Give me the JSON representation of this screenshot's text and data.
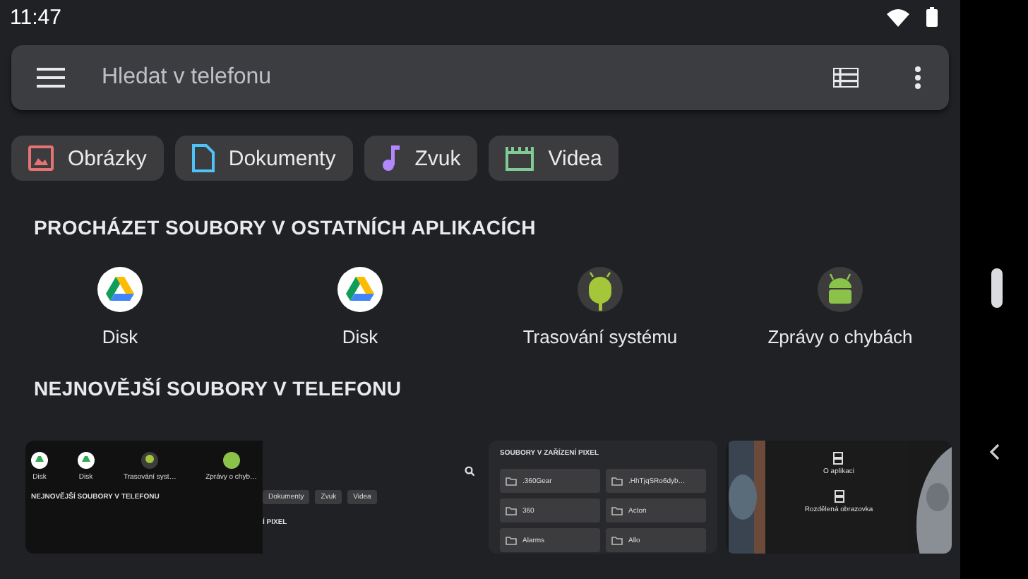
{
  "status_bar": {
    "time": "11:47"
  },
  "search": {
    "placeholder": "Hledat v telefonu"
  },
  "categories": [
    {
      "label": "Obrázky",
      "kind": "images",
      "color": "#e57373"
    },
    {
      "label": "Dokumenty",
      "kind": "docs",
      "color": "#4fc3f7"
    },
    {
      "label": "Zvuk",
      "kind": "audio",
      "color": "#b388ff"
    },
    {
      "label": "Videa",
      "kind": "video",
      "color": "#81c995"
    }
  ],
  "browse_heading": "PROCHÁZET SOUBORY V OSTATNÍCH APLIKACÍCH",
  "apps": [
    {
      "label": "Disk",
      "kind": "drive"
    },
    {
      "label": "Disk",
      "kind": "drive"
    },
    {
      "label": "Trasování systému",
      "kind": "tracing"
    },
    {
      "label": "Zprávy o chybách",
      "kind": "android"
    }
  ],
  "recent_heading": "NEJNOVĚJŠÍ SOUBORY V TELEFONU",
  "recent": {
    "thumb_1": {
      "apps": [
        "Disk",
        "Disk",
        "Trasování syst…",
        "Zprávy o chyb…"
      ],
      "heading": "NEJNOVĚJŠÍ SOUBORY V TELEFONU",
      "chips": [
        "Dokumenty",
        "Zvuk",
        "Videa"
      ],
      "fragment": "Í PIXEL"
    },
    "thumb_2": {
      "heading": "SOUBORY V ZAŘÍZENÍ PIXEL",
      "folders": [
        ".360Gear",
        ".HhTjqSRo6dyb…",
        "360",
        "Acton",
        "Alarms",
        "Allo"
      ]
    },
    "thumb_3": {
      "items": [
        "O aplikaci",
        "Rozdělená obrazovka"
      ]
    }
  }
}
